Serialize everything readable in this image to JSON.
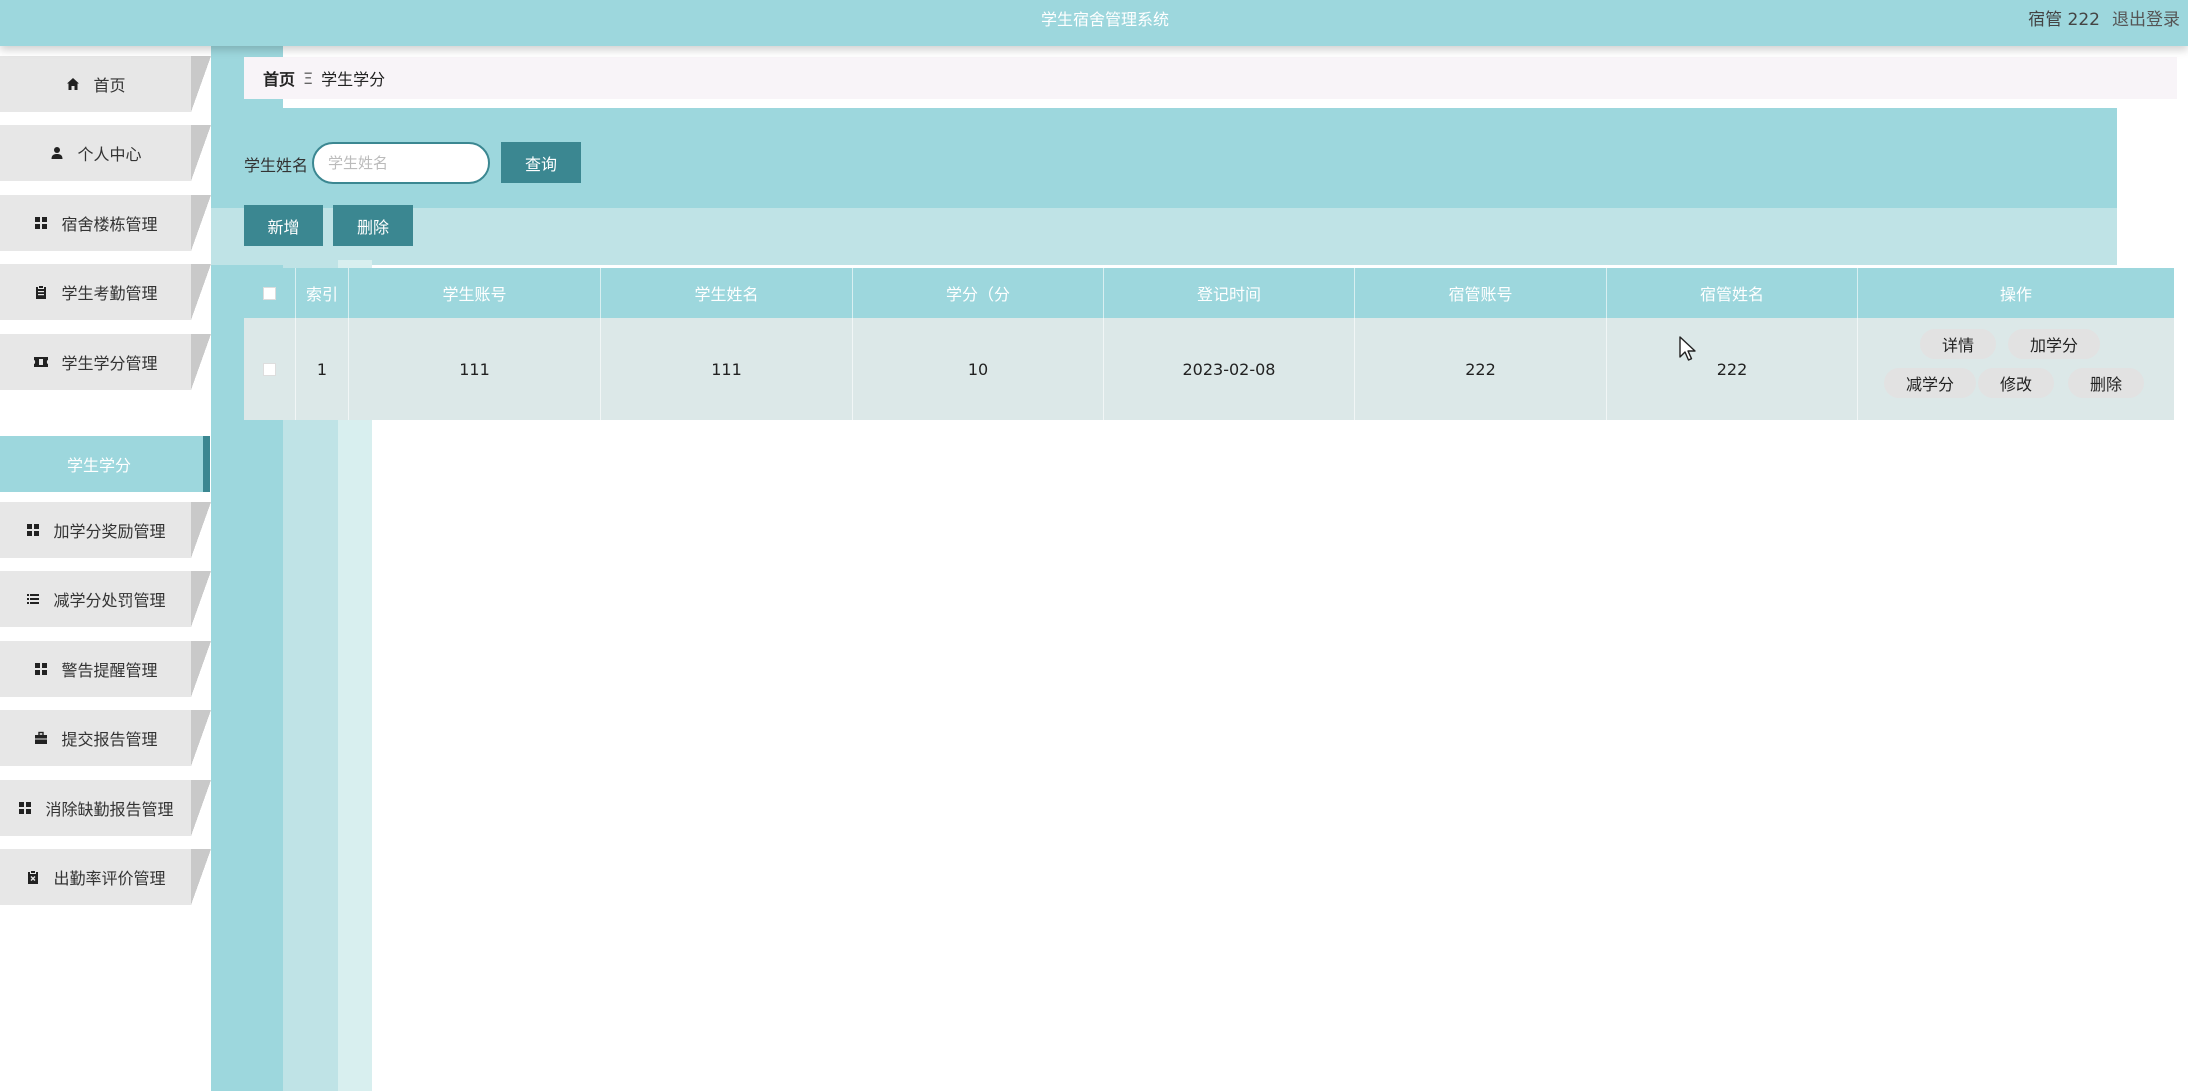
{
  "app": {
    "title": "学生宿舍管理系统",
    "user": "宿管 222",
    "logout": "退出登录"
  },
  "sidebar": {
    "items": [
      {
        "label": "首页",
        "icon": "home-icon"
      },
      {
        "label": "个人中心",
        "icon": "user-icon"
      },
      {
        "label": "宿舍楼栋管理",
        "icon": "grid-icon"
      },
      {
        "label": "学生考勤管理",
        "icon": "clipboard-icon"
      },
      {
        "label": "学生学分管理",
        "icon": "ticket-icon"
      },
      {
        "label": "加学分奖励管理",
        "icon": "grid-icon"
      },
      {
        "label": "减学分处罚管理",
        "icon": "list-icon"
      },
      {
        "label": "警告提醒管理",
        "icon": "grid-icon"
      },
      {
        "label": "提交报告管理",
        "icon": "briefcase-icon"
      },
      {
        "label": "消除缺勤报告管理",
        "icon": "grid-icon"
      },
      {
        "label": "出勤率评价管理",
        "icon": "clipboard-x-icon"
      }
    ],
    "active_sub": "学生学分"
  },
  "breadcrumb": {
    "home": "首页",
    "separator": "Ξ",
    "current": "学生学分"
  },
  "search": {
    "label": "学生姓名",
    "placeholder": "学生姓名",
    "query_button": "查询"
  },
  "actions": {
    "add": "新增",
    "delete": "删除"
  },
  "table": {
    "headers": [
      "索引",
      "学生账号",
      "学生姓名",
      "学分（分",
      "登记时间",
      "宿管账号",
      "宿管姓名",
      "操作"
    ],
    "rows": [
      {
        "index": "1",
        "student_account": "111",
        "student_name": "111",
        "credits": "10",
        "registered": "2023-02-08",
        "manager_account": "222",
        "manager_name": "222",
        "ops": [
          "详情",
          "加学分",
          "减学分",
          "修改",
          "删除"
        ]
      }
    ]
  },
  "colors": {
    "accent": "#3b8791",
    "teal_light": "#9dd7dd",
    "teal_pale": "#bfe3e6"
  }
}
